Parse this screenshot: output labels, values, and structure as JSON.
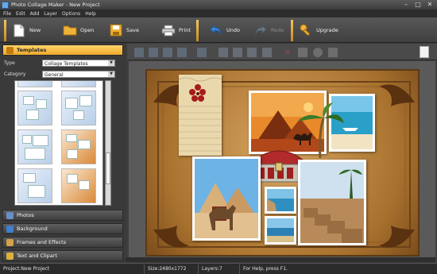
{
  "window": {
    "title": "Photo Collage Maker - New Project"
  },
  "menu": [
    "File",
    "Edit",
    "Add",
    "Layer",
    "Options",
    "Help"
  ],
  "toolbar": {
    "new_label": "New",
    "open_label": "Open",
    "save_label": "Save",
    "print_label": "Print",
    "undo_label": "Undo",
    "redo_label": "Redo",
    "upgrade_label": "Upgrade"
  },
  "left": {
    "templates_header": "Templates",
    "type_label": "Type",
    "type_value": "Collage Templates",
    "category_label": "Category",
    "category_value": "General",
    "sections": [
      "Photos",
      "Background",
      "Frames and Effects",
      "Text and Clipart"
    ]
  },
  "status": {
    "project": "Project:New Project",
    "size": "Size:2480x1772",
    "layers": "Layers:7",
    "help": "For Help, press F1."
  },
  "colors": {
    "accent": "#f2b233",
    "panel": "#3a3a3a",
    "canvas_bg": "#b98240"
  },
  "icons": [
    "window-icon",
    "new-icon",
    "open-icon",
    "save-icon",
    "print-icon",
    "undo-icon",
    "redo-icon",
    "upgrade-icon",
    "doc-icon"
  ]
}
